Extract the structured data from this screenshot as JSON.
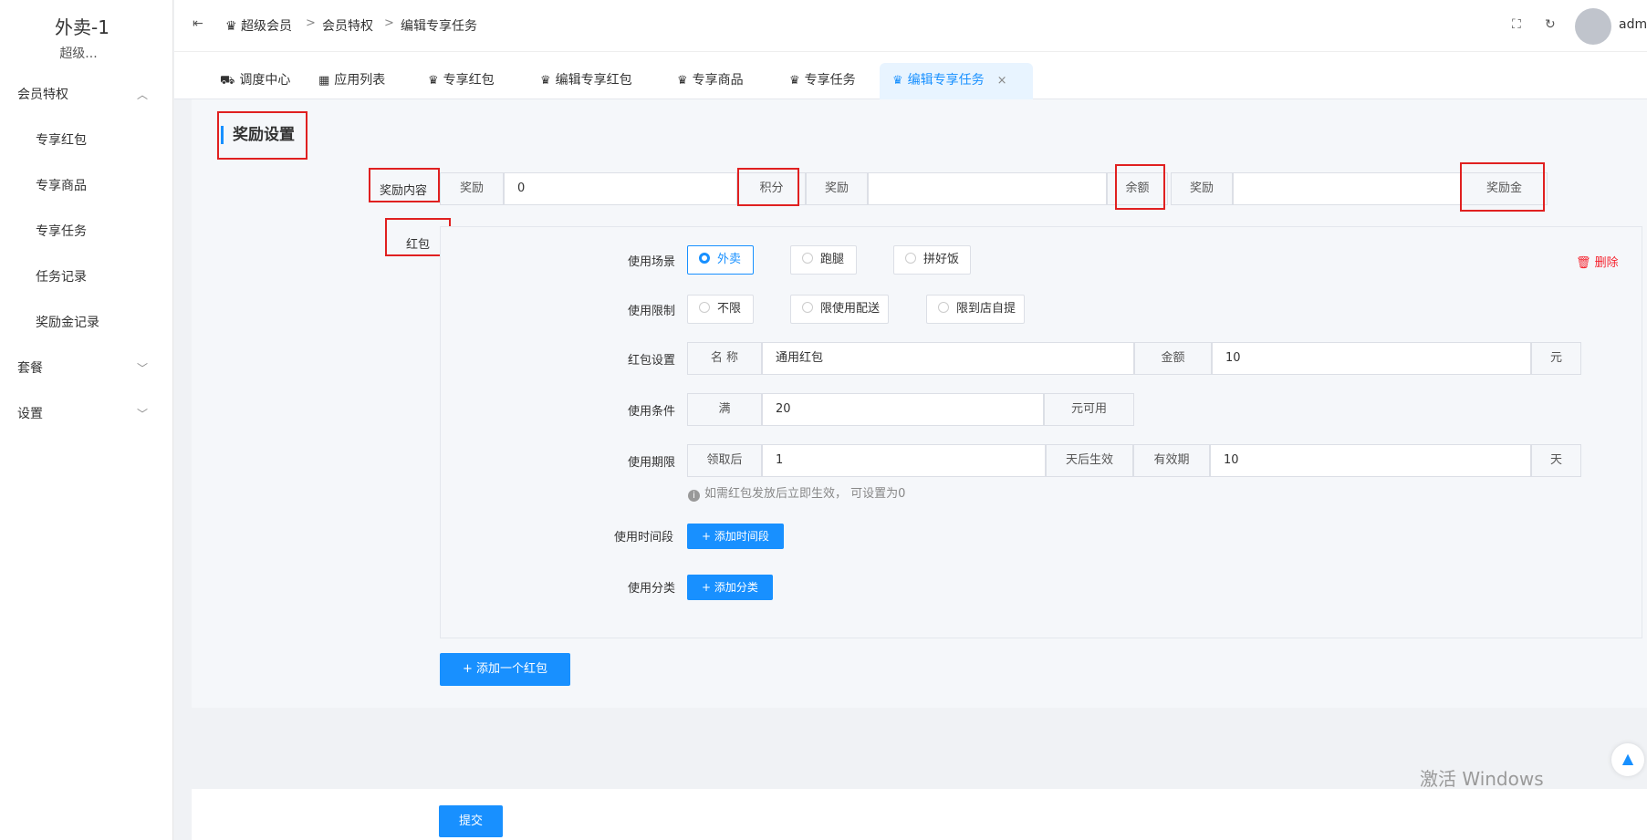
{
  "sidebar": {
    "logo_title": "外卖-1",
    "logo_sub": "超级...",
    "groups": [
      {
        "label": "会员特权",
        "chevron": "chevron-up-icon"
      },
      {
        "label": "套餐",
        "chevron": "chevron-down-icon"
      },
      {
        "label": "设置",
        "chevron": "chevron-down-icon"
      }
    ],
    "items": [
      "专享红包",
      "专享商品",
      "专享任务",
      "任务记录",
      "奖励金记录"
    ]
  },
  "header": {
    "breadcrumb": [
      "超级会员",
      "会员特权",
      "编辑专享任务"
    ],
    "separator": ">",
    "user": "admin"
  },
  "tabs": [
    {
      "label": "调度中心",
      "icon": "truck-icon"
    },
    {
      "label": "应用列表",
      "icon": "apps-icon"
    },
    {
      "label": "专享红包",
      "icon": "crown-icon"
    },
    {
      "label": "编辑专享红包",
      "icon": "crown-icon"
    },
    {
      "label": "专享商品",
      "icon": "crown-icon"
    },
    {
      "label": "专享任务",
      "icon": "crown-icon"
    },
    {
      "label": "编辑专享任务",
      "icon": "crown-icon",
      "active": true
    }
  ],
  "form": {
    "section_title": "奖励设置",
    "reward_content_label": "奖励内容",
    "reward_prefix": "奖励",
    "points_value": "0",
    "points_suffix": "积分",
    "balance_value": "",
    "balance_suffix": "余额",
    "bonus_value": "",
    "bonus_suffix": "奖励金",
    "redpacket_label": "红包",
    "scene_label": "使用场景",
    "scene_options": [
      "外卖",
      "跑腿",
      "拼好饭"
    ],
    "scene_selected": "外卖",
    "delete_label": "删除",
    "limit_label": "使用限制",
    "limit_options": [
      "不限",
      "限使用配送",
      "限到店自提"
    ],
    "rp_setting_label": "红包设置",
    "name_addon": "名 称",
    "name_value": "通用红包",
    "amount_addon": "金额",
    "amount_value": "10",
    "amount_unit": "元",
    "condition_label": "使用条件",
    "condition_prefix": "满",
    "condition_value": "20",
    "condition_suffix": "元可用",
    "period_label": "使用期限",
    "period_prefix": "领取后",
    "period_value": "1",
    "period_mid": "天后生效",
    "validity_addon": "有效期",
    "validity_value": "10",
    "validity_unit": "天",
    "hint": "如需红包发放后立即生效，  可设置为0",
    "time_label": "使用时间段",
    "add_time": "+ 添加时间段",
    "category_label": "使用分类",
    "add_category": "+ 添加分类",
    "add_redpacket": "+ 添加一个红包",
    "submit": "提交"
  },
  "watermark": "激活 Windows",
  "colors": {
    "primary": "#1890ff",
    "danger": "#f5222d",
    "annotation_red": "#e02020"
  }
}
